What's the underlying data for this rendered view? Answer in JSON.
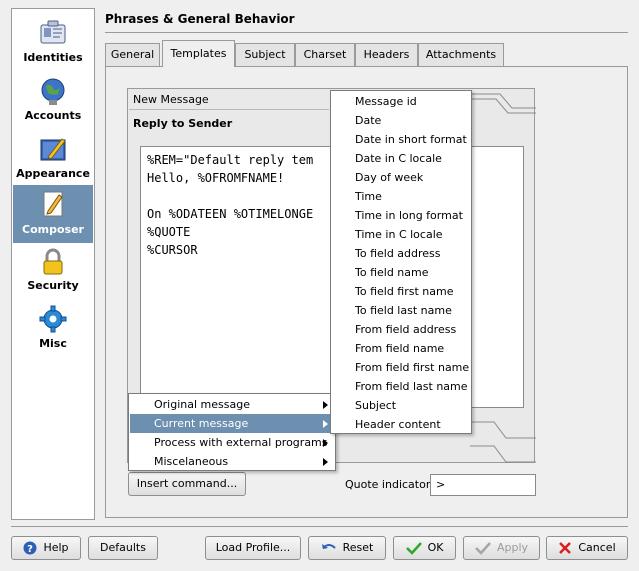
{
  "window": {
    "section_title": "Phrases & General Behavior"
  },
  "sidebar": {
    "items": [
      {
        "label": "Identities",
        "icon": "identities-icon"
      },
      {
        "label": "Accounts",
        "icon": "accounts-icon"
      },
      {
        "label": "Appearance",
        "icon": "appearance-icon"
      },
      {
        "label": "Composer",
        "icon": "composer-icon",
        "active": true
      },
      {
        "label": "Security",
        "icon": "security-icon"
      },
      {
        "label": "Misc",
        "icon": "misc-icon"
      }
    ]
  },
  "tabs": [
    {
      "label": "General"
    },
    {
      "label": "Templates",
      "active": true
    },
    {
      "label": "Subject"
    },
    {
      "label": "Charset"
    },
    {
      "label": "Headers"
    },
    {
      "label": "Attachments"
    }
  ],
  "templates": {
    "list_item": "New Message",
    "current_title": "Reply to Sender",
    "editor_lines": [
      "%REM=\"Default reply tem",
      "Hello, %OFROMFNAME!",
      "",
      "On %ODATEEN %OTIMELONGE",
      "%QUOTE",
      "%CURSOR"
    ]
  },
  "insert_menu": {
    "items": [
      {
        "label": "Original message",
        "has_submenu": true
      },
      {
        "label": "Current message",
        "has_submenu": true,
        "highlighted": true
      },
      {
        "label": "Process with external programs",
        "has_submenu": true
      },
      {
        "label": "Miscelaneous",
        "has_submenu": true
      }
    ]
  },
  "current_message_submenu": [
    "Message id",
    "Date",
    "Date in short format",
    "Date in C locale",
    "Day of week",
    "Time",
    "Time in long format",
    "Time in C locale",
    "To field address",
    "To field name",
    "To field first name",
    "To field last name",
    "From field address",
    "From field name",
    "From field first name",
    "From field last name",
    "Subject",
    "Header content"
  ],
  "controls": {
    "insert_command_label": "Insert command...",
    "quote_indicator_label": "Quote indicator:",
    "quote_indicator_value": ">"
  },
  "buttons": {
    "help": "Help",
    "defaults": "Defaults",
    "load_profile": "Load Profile...",
    "reset": "Reset",
    "ok": "OK",
    "apply": "Apply",
    "cancel": "Cancel"
  },
  "colors": {
    "selection": "#6d8fb0",
    "ok_check": "#2ea82e",
    "cancel_x": "#d81e1e",
    "help_blue": "#2c5fb5"
  }
}
